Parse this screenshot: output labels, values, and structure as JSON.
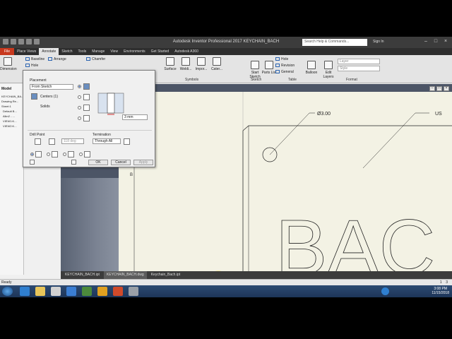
{
  "app": {
    "window_title": "Autodesk Inventor Professional 2017    KEYCHAIN_BACH",
    "search_placeholder": "Search Help & Commands...",
    "sign_in": "Sign In"
  },
  "ribbon_tabs": [
    "File",
    "Place Views",
    "Annotate",
    "Sketch",
    "Tools",
    "Manage",
    "View",
    "Environments",
    "Get Started",
    "Autodesk A360"
  ],
  "ribbon": {
    "dimension": "Dimension",
    "baseline": "Baseline",
    "arrange": "Arrange",
    "chamfer": "Chamfer",
    "hole": "Hole",
    "surface": "Surface",
    "welding": "Weldi...",
    "import": "Impor...",
    "caterpillar": "Cater...",
    "start_sketch": "Start Sketch",
    "parts_list": "Parts List",
    "hole_table": "Hole",
    "revision": "Revision",
    "general": "General",
    "balloon": "Balloon",
    "edit_layers": "Edit Layers",
    "layer_placeholder": "Layer",
    "style_placeholder": "Style",
    "groups": {
      "symbols": "Symbols",
      "sketch": "Sketch",
      "table": "Table",
      "format": "Format"
    }
  },
  "browser": {
    "header": "Model",
    "nodes": [
      "KEYCHAIN_BA...",
      "Drawing Re...",
      "Sheet:1",
      "Default B...",
      "Alkn2 - ...",
      "VIEW1:K...",
      "VIEW2:K..."
    ]
  },
  "hole_dialog": {
    "placement_label": "Placement",
    "placement_value": "From Sketch",
    "centers": "Centers (1)",
    "solids": "Solids",
    "dimension_value": "3 mm",
    "drill_point_label": "Drill Point",
    "drill_angle": "118 deg",
    "termination_label": "Termination",
    "termination_value": "Through All",
    "ok": "OK",
    "cancel": "Cancel",
    "apply": "Apply"
  },
  "drawing": {
    "hole_note": "Ø3.00",
    "edge_note": "US",
    "text": "BAC",
    "zone_letter": "B"
  },
  "document_tabs": [
    "KEYCHAIN_BACH.ipt",
    "KEYCHAIN_BACH.dwg",
    "Keychain_Bach.ipt"
  ],
  "status": {
    "ready": "Ready",
    "page_a": "1",
    "page_b": "3"
  },
  "taskbar": {
    "time": "3:08 PM",
    "date": "11/15/2018"
  },
  "colors": {
    "file_tab": "#c8391e",
    "drawing_paper": "#f3f2e4",
    "taskbar": "#1d3558"
  }
}
